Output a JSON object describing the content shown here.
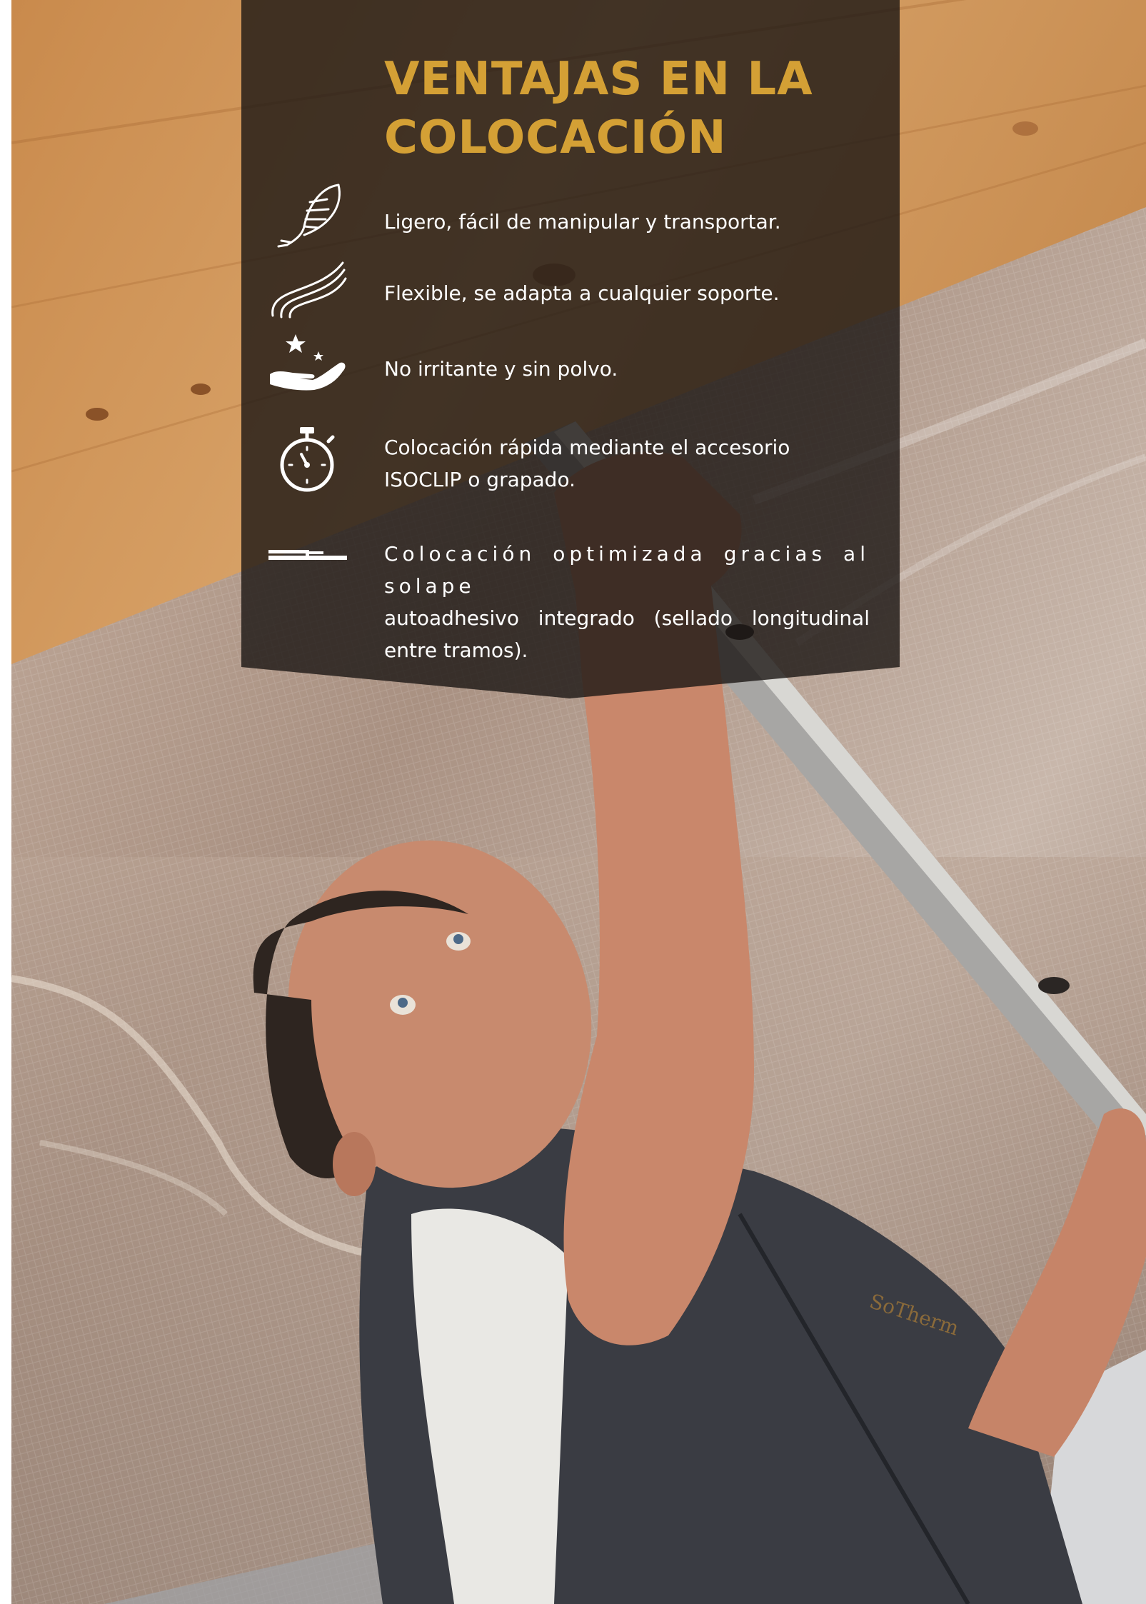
{
  "title": "VENTAJAS EN LA COLOCACIÓN",
  "features": [
    {
      "icon": "feather-icon",
      "text": "Ligero, fácil de manipular y transportar."
    },
    {
      "icon": "waves-icon",
      "text": "Flexible, se adapta a cualquier soporte."
    },
    {
      "icon": "hand-stars-icon",
      "text": "No irritante y sin polvo."
    },
    {
      "icon": "stopwatch-icon",
      "text": "Colocación rápida mediante el accesorio ISOCLIP o grapado."
    },
    {
      "icon": "overlap-icon",
      "text_line1": "Colocación optimizada gracias al solape",
      "text_rest": "autoadhesivo integrado (sellado longitudinal entre tramos)."
    }
  ],
  "colors": {
    "title": "#d4a035",
    "panel": "#1c1714",
    "text": "#ffffff"
  }
}
